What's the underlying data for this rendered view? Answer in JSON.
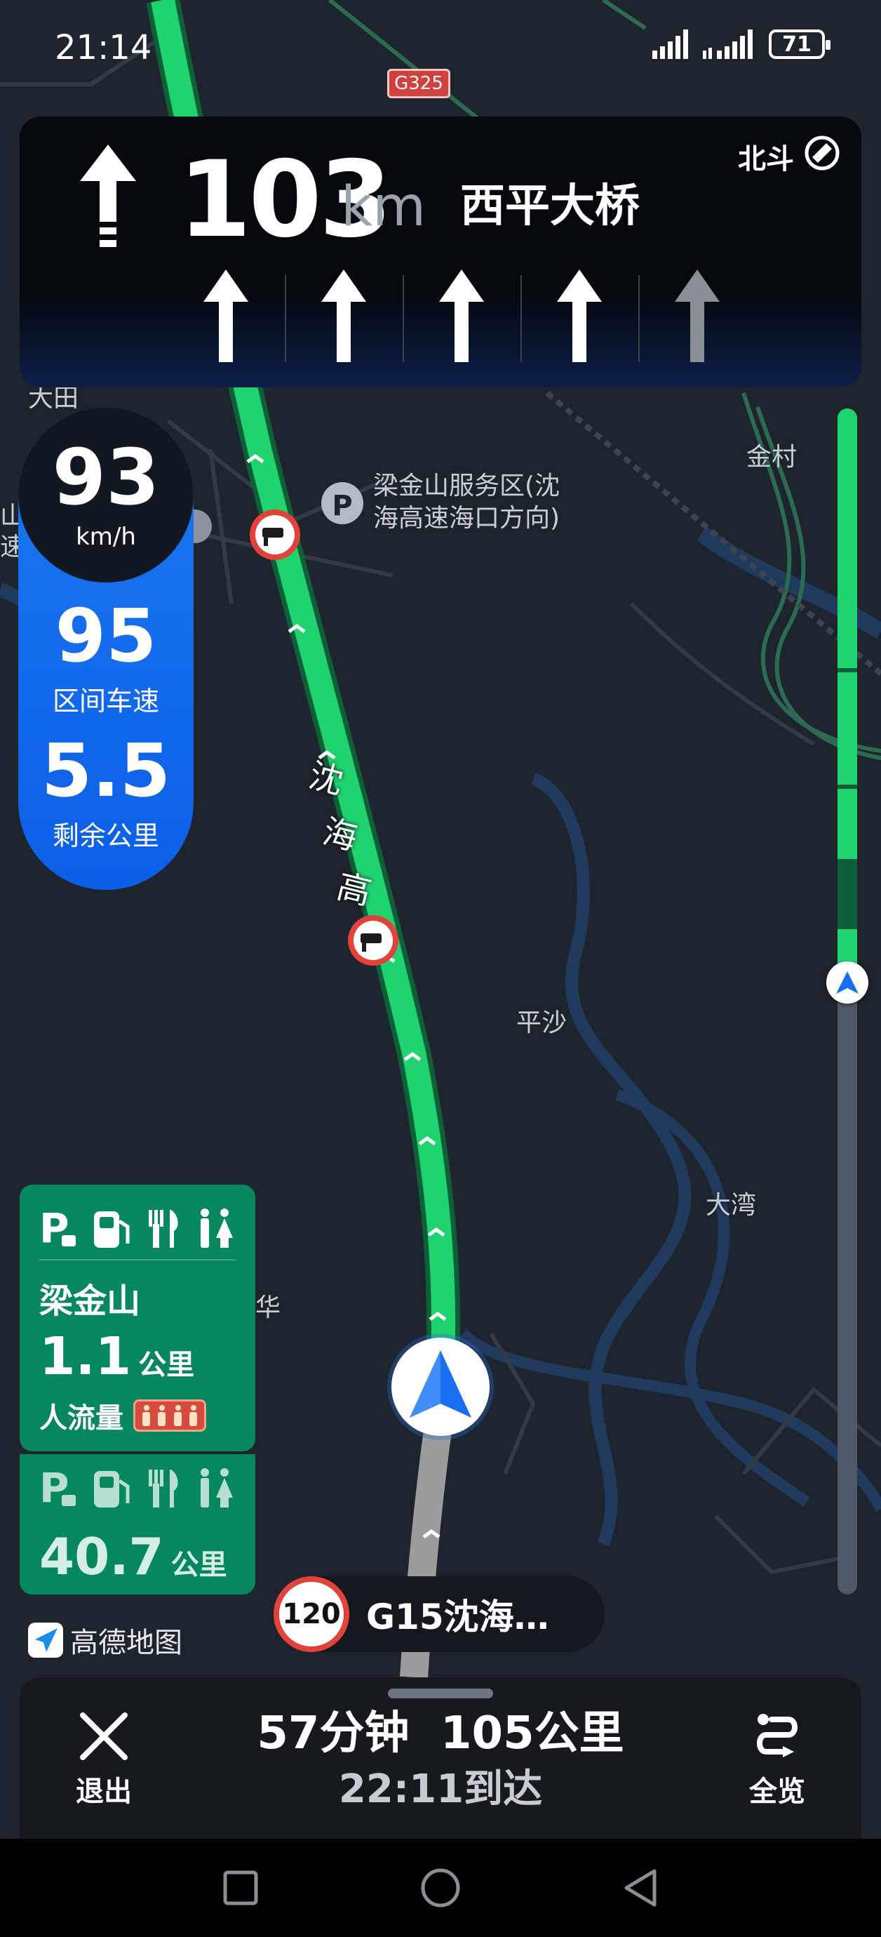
{
  "status_bar": {
    "time": "21:14",
    "battery": "71"
  },
  "map": {
    "road_shield": "G325",
    "road_name_vertical": [
      "沈",
      "海",
      "高"
    ],
    "labels": {
      "service_area": "梁金山服务区(沈\n海高速海口方向)",
      "jincun": "金村",
      "pingsha": "平沙",
      "dawan": "大湾",
      "hua": "华",
      "tian": "大田",
      "shan": "山",
      "su": "速"
    }
  },
  "guidance": {
    "distance": "103",
    "unit": "km",
    "road": "西平大桥",
    "satellite": "北斗",
    "lanes": [
      "straight",
      "straight",
      "straight",
      "straight",
      "straight-dim"
    ]
  },
  "speed_panel": {
    "speed": "93",
    "speed_unit": "km/h",
    "section_speed": "95",
    "section_speed_label": "区间车速",
    "remaining": "5.5",
    "remaining_label": "剩余公里"
  },
  "service_area": {
    "name": "梁金山",
    "distance": "1.1",
    "distance_unit": "公里",
    "crowd_label": "人流量",
    "next_distance": "40.7",
    "next_distance_unit": "公里"
  },
  "logo": {
    "text": "高德地图"
  },
  "speed_limit": {
    "value": "120",
    "road": "G15沈海…"
  },
  "route_progress": 0.28,
  "bottom_bar": {
    "exit_label": "退出",
    "duration": "57分钟",
    "distance": "105公里",
    "arrival": "22:11到达",
    "overview_label": "全览"
  },
  "colors": {
    "route": "#1fd36e",
    "speed_panel": "#1268ec",
    "service_card": "#078760",
    "limit_ring": "#e2413c"
  }
}
